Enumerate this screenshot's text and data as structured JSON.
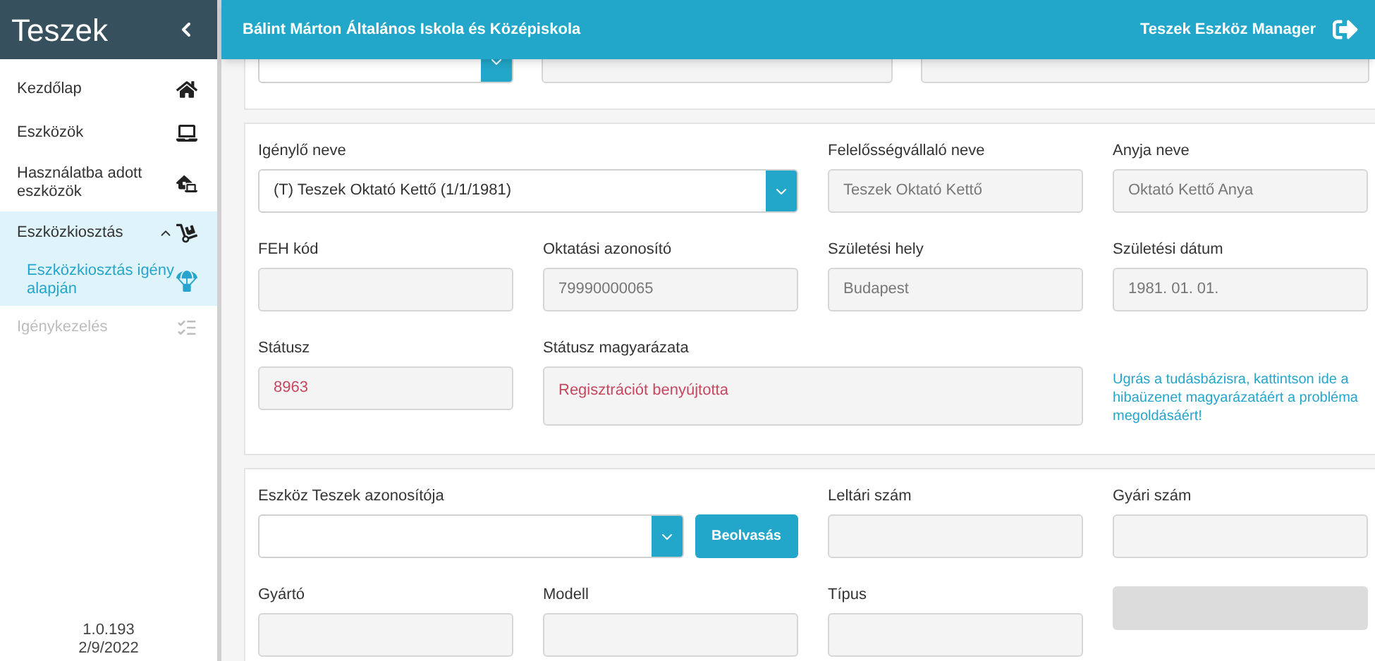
{
  "sidebar": {
    "title": "Teszek",
    "items": [
      {
        "label": "Kezdőlap",
        "selected": false,
        "disabled": false
      },
      {
        "label": "Eszközök",
        "selected": false,
        "disabled": false
      },
      {
        "label": "Használatba adott eszközök",
        "selected": false,
        "disabled": false
      },
      {
        "label": "Eszközkiosztás",
        "selected": true,
        "disabled": false,
        "expanded": true,
        "children": [
          {
            "label": "Eszközkiosztás igény alapján",
            "selected": true,
            "disabled": false
          }
        ]
      },
      {
        "label": "Igénykezelés",
        "selected": false,
        "disabled": true
      }
    ],
    "version": "1.0.193",
    "date": "2/9/2022"
  },
  "header": {
    "school": "Bálint Márton Általános Iskola és Középiskola",
    "app_name": "Teszek Eszköz Manager"
  },
  "top_section": {
    "fields": [
      {
        "kind": "select"
      },
      {
        "kind": "input"
      },
      {
        "kind": "input"
      }
    ]
  },
  "sections": [
    {
      "rows": [
        [
          {
            "label": "Igénylő neve",
            "value": "(T) Teszek Oktató Kettő (1/1/1981)",
            "kind": "select"
          },
          "",
          {
            "label": "Felelősségvállaló neve",
            "value": "Teszek Oktató Kettő",
            "kind": "input",
            "error": false
          },
          {
            "label": "Anyja neve",
            "value": "Oktató Kettő Anya",
            "kind": "input",
            "error": false
          }
        ],
        [
          {
            "label": "FEH kód",
            "kind": "input"
          },
          {
            "label": "Oktatási azonosító",
            "value": "79990000065",
            "kind": "input",
            "error": false
          },
          {
            "label": "Születési hely",
            "value": "Budapest",
            "kind": "input",
            "error": false
          },
          {
            "label": "Születési dátum",
            "value": "1981. 01. 01.",
            "kind": "input",
            "error": false
          }
        ],
        [
          {
            "label": "Státusz",
            "value": "8963",
            "kind": "input",
            "error": true
          },
          {
            "label": "Státusz magyarázata",
            "value": "Regisztrációt benyújtotta",
            "kind": "textarea",
            "error": true
          },
          "",
          {
            "value": "Ugrás a tudásbázisra, kattintson ide a hibaüzenet magyarázatáért a probléma megoldásáért!",
            "kind": "link"
          }
        ]
      ]
    },
    {
      "rows": [
        [
          {
            "label": "Eszköz Teszek azonosítója",
            "kind": "select",
            "button": "Beolvasás"
          },
          "",
          {
            "label": "Leltári szám",
            "kind": "input"
          },
          {
            "label": "Gyári szám",
            "kind": "input"
          }
        ],
        [
          {
            "label": "Gyártó",
            "kind": "input"
          },
          {
            "label": "Modell",
            "kind": "input"
          },
          {
            "label": "Típus",
            "kind": "input"
          },
          {
            "kind": "blank"
          }
        ]
      ]
    }
  ]
}
